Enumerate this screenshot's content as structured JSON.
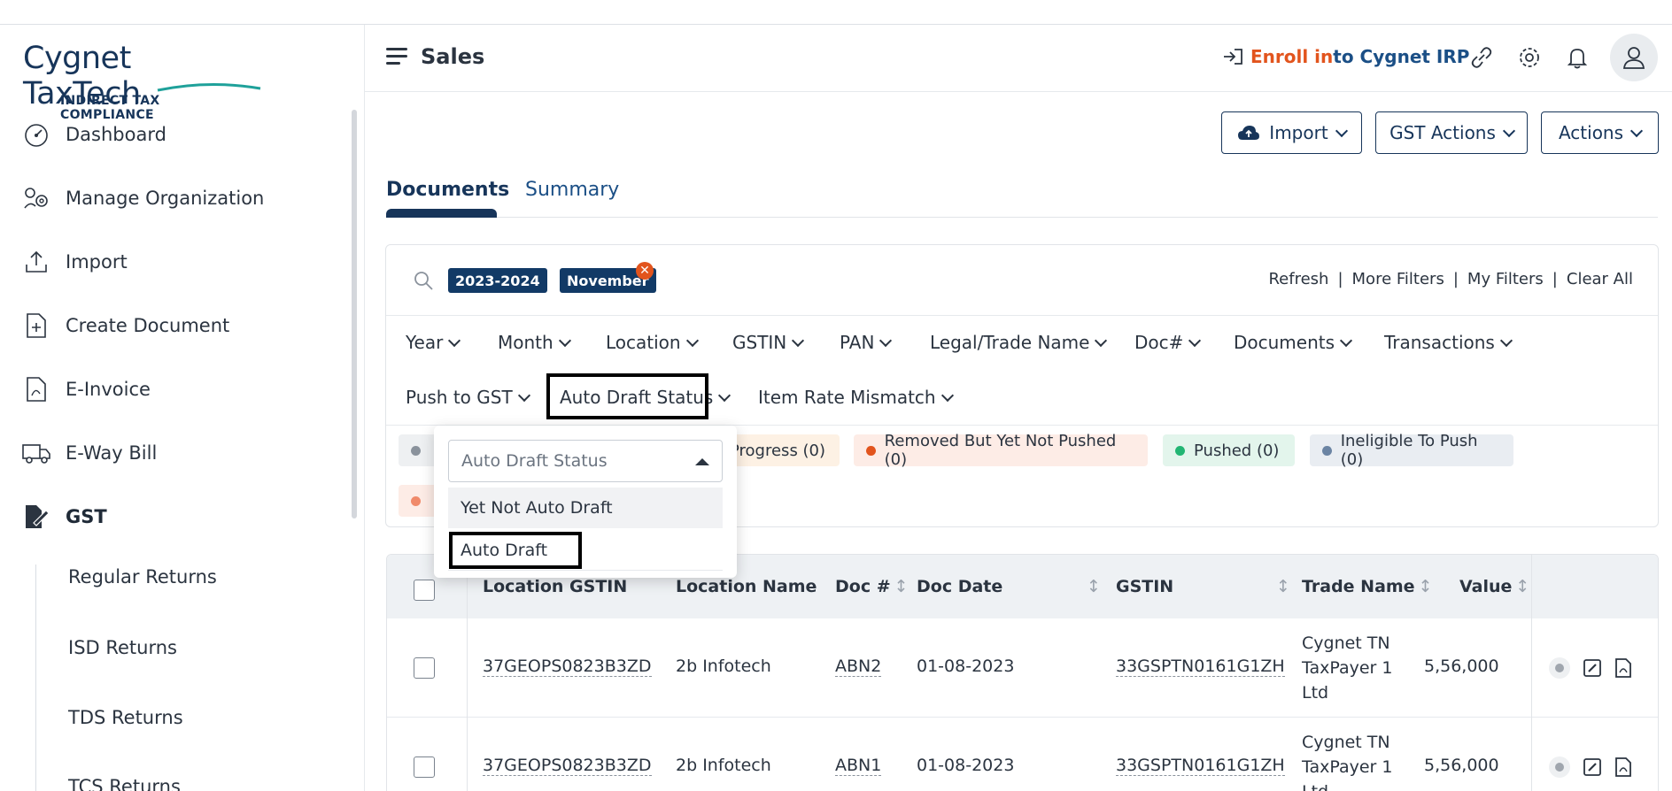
{
  "brand": {
    "name_part1": "Cygnet",
    "name_part2": "TaxTech",
    "tagline": "INDIRECT TAX COMPLIANCE"
  },
  "sidebar": {
    "items": [
      {
        "label": "Dashboard",
        "icon": "dashboard-gauge-icon"
      },
      {
        "label": "Manage Organization",
        "icon": "organization-gears-icon"
      },
      {
        "label": "Import",
        "icon": "upload-tray-icon"
      },
      {
        "label": "Create Document",
        "icon": "document-plus-icon"
      },
      {
        "label": "E-Invoice",
        "icon": "invoice-icon"
      },
      {
        "label": "E-Way Bill",
        "icon": "truck-icon"
      },
      {
        "label": "GST",
        "icon": "gst-edit-icon"
      }
    ],
    "sub_items": [
      "Regular Returns",
      "ISD Returns",
      "TDS Returns",
      "TCS Returns"
    ]
  },
  "header": {
    "title": "Sales",
    "enroll_part1": "Enroll in",
    "enroll_part2": "to Cygnet IRP"
  },
  "toolbar": {
    "import_label": "Import",
    "gst_actions_label": "GST Actions",
    "actions_label": "Actions"
  },
  "tabs": [
    {
      "label": "Documents",
      "active": true
    },
    {
      "label": "Summary",
      "active": false
    }
  ],
  "filters": {
    "chips": [
      "2023-2024",
      "November"
    ],
    "links": [
      "Refresh",
      "More Filters",
      "My Filters",
      "Clear All"
    ],
    "dropdowns_row1": [
      "Year",
      "Month",
      "Location",
      "GSTIN",
      "PAN",
      "Legal/Trade Name",
      "Doc#",
      "Documents",
      "Transactions"
    ],
    "dropdowns_row2": [
      "Push to GST",
      "Auto Draft Status",
      "Item Rate Mismatch"
    ]
  },
  "status_pills": [
    {
      "label": "Progress (0)",
      "color": "#fdf1e4",
      "dot": null
    },
    {
      "label": "Removed But Yet Not Pushed (0)",
      "color": "#fdece6",
      "dot": "#e2541d"
    },
    {
      "label": "Pushed (0)",
      "color": "#e3f5ec",
      "dot": "#22b573"
    },
    {
      "label": "Ineligible To Push (0)",
      "color": "#e9edf2",
      "dot": "#6b84a3"
    }
  ],
  "popup": {
    "placeholder": "Auto Draft Status",
    "options": [
      "Yet Not Auto Draft",
      "Auto Draft"
    ]
  },
  "table": {
    "columns": [
      "Location GSTIN",
      "Location Name",
      "Doc #",
      "Doc Date",
      "GSTIN",
      "Trade Name",
      "Value"
    ],
    "rows": [
      {
        "location_gstin": "37GEOPS0823B3ZD",
        "location_name": "2b Infotech",
        "doc": "ABN2",
        "doc_date": "01-08-2023",
        "gstin": "33GSPTN0161G1ZH",
        "trade_line1": "Cygnet TN",
        "trade_line2": "TaxPayer 1",
        "trade_line3": "Ltd",
        "value": "5,56,000"
      },
      {
        "location_gstin": "37GEOPS0823B3ZD",
        "location_name": "2b Infotech",
        "doc": "ABN1",
        "doc_date": "01-08-2023",
        "gstin": "33GSPTN0161G1ZH",
        "trade_line1": "Cygnet TN",
        "trade_line2": "TaxPayer 1",
        "trade_line3": "Ltd",
        "value": "5,56,000"
      }
    ]
  },
  "colors": {
    "brand_navy": "#17355a",
    "accent_orange": "#e2541d"
  }
}
